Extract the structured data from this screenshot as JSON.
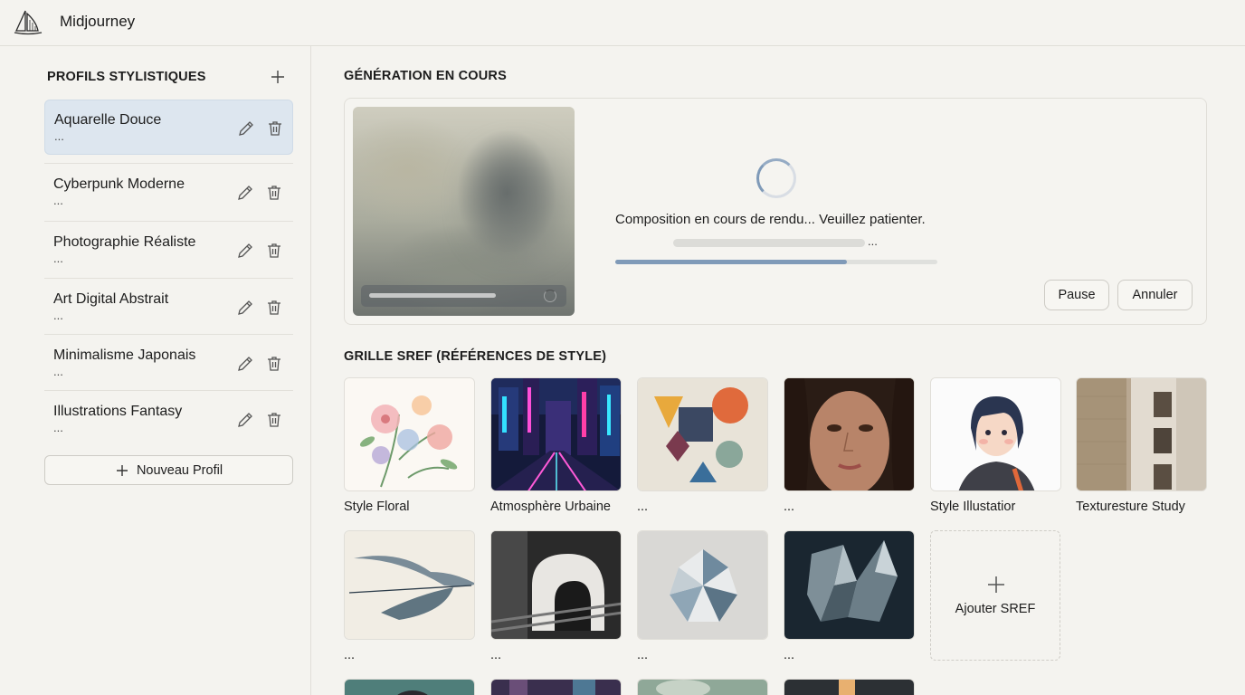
{
  "app": {
    "title": "Midjourney",
    "logo_icon": "sailboat-icon"
  },
  "sidebar": {
    "heading": "PROFILS STYLISTIQUES",
    "add_icon": "plus-icon",
    "profiles": [
      {
        "name": "Aquarelle Douce",
        "sub": "...",
        "active": true
      },
      {
        "name": "Cyberpunk Moderne",
        "sub": "..."
      },
      {
        "name": "Photographie Réaliste",
        "sub": "..."
      },
      {
        "name": "Art Digital Abstrait",
        "sub": "..."
      },
      {
        "name": "Minimalisme Japonais",
        "sub": "..."
      },
      {
        "name": "Illustrations Fantasy",
        "sub": "..."
      }
    ],
    "new_profile_label": "Nouveau Profil"
  },
  "generation": {
    "heading": "GÉNÉRATION EN COURS",
    "message": "Composition en cours de rendu... Veuillez patienter.",
    "sub_text": "...",
    "progress": 0.72,
    "pause_label": "Pause",
    "cancel_label": "Annuler",
    "accent": "#7f9ab8"
  },
  "sref_grid": {
    "heading": "GRILLE SREF (RÉFÉRENCES DE STYLE)",
    "row1": [
      {
        "label": "Style Floral"
      },
      {
        "label": "Atmosphère Urbaine"
      },
      {
        "label": "..."
      },
      {
        "label": "..."
      },
      {
        "label": "Style Illustatior"
      },
      {
        "label": "Texturesture Study"
      }
    ],
    "row2": [
      {
        "label": "..."
      },
      {
        "label": "..."
      },
      {
        "label": "..."
      },
      {
        "label": "..."
      }
    ],
    "add_label": "Ajouter SREF"
  }
}
